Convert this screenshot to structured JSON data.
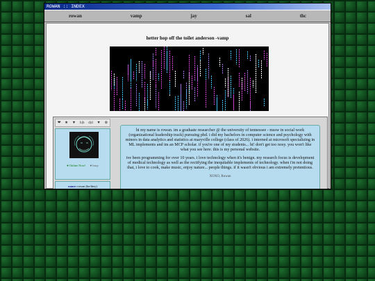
{
  "window": {
    "title": "ROWAN :: INDEX"
  },
  "nav": [
    "rowan",
    "vamp",
    "jay",
    "sal",
    "thc"
  ],
  "headline": "hetter hop off the toilet anderson -vamp",
  "toolbar": [
    "❤",
    "★",
    "▼",
    "h|b",
    "d|d",
    "▼",
    "⊗"
  ],
  "status": {
    "online": "Online Now!",
    "busy": "busy"
  },
  "profile": {
    "name_label": "name:",
    "name_value": "rowan (he/they)"
  },
  "bio": {
    "p1": "hi my name is rowan. im a graduate researcher @ the university of tennessee - mssw in social work (organizational leadership track) pursuing phd. i did my bachelors in computer science and psychology with minors in data analytics and statistics at maryville college (class of 2026). i interned at microsoft specializing in ML implements and im an MCP scholar. if you're one of my students... hi! don't get too nosy. you won't like what you see here. this is my personal website.",
    "p2": "ive been programming for over 10 years. i love technology when it's benign. my research focus is development of medical technology as well as the rectifying the inequitable implements of technology. when i'm not doing that, i love to cook, make music, enjoy nature... people things. if it wasn't obvious i am extremely pretentious.",
    "sig": "XOXO, Rowan"
  },
  "colors": {
    "panel": "#b8dcef",
    "matrix_pink": "#d040d0",
    "matrix_cyan": "#40c0f0"
  }
}
